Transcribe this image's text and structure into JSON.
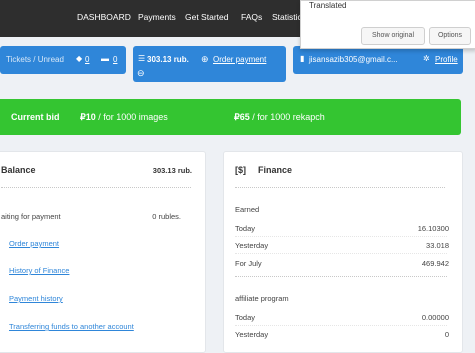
{
  "topnav": {
    "items": [
      "DASHBOARD",
      "Payments",
      "Get Started",
      "FAQs",
      "Statistics"
    ]
  },
  "infobar": {
    "tickets_label": "Tickets / Unread",
    "tickets_count": "0",
    "unread_count": "0",
    "balance": "303.13 rub.",
    "order_payment": "Order payment",
    "email": "jisansazib305@gmail.c...",
    "profile": "Profile"
  },
  "bid": {
    "label": "Current bid",
    "rate1_price": "₽10",
    "rate1_desc": "/ for 1000 images",
    "rate2_price": "₽65",
    "rate2_desc": "/ for 1000 rekapch"
  },
  "balance_card": {
    "title": "Balance",
    "amount": "303.13 rub.",
    "waiting_label": "aiting for payment",
    "waiting_value": "0 rubles.",
    "links": [
      "Order payment",
      "History of Finance",
      "Payment history",
      "Transferring funds to another account"
    ]
  },
  "finance_card": {
    "icon_text": "[$]",
    "title": "Finance",
    "earned_label": "Earned",
    "earned_rows": [
      {
        "label": "Today",
        "value": "16.10300"
      },
      {
        "label": "Yesterday",
        "value": "33.018"
      },
      {
        "label": "For July",
        "value": "469.942"
      }
    ],
    "affiliate_label": "affiliate program",
    "affiliate_rows": [
      {
        "label": "Today",
        "value": "0.00000"
      },
      {
        "label": "Yesterday",
        "value": "0"
      }
    ]
  },
  "translate_popup": {
    "title": "Translated",
    "show_original": "Show original",
    "options": "Options"
  },
  "colors": {
    "nav_bg": "#2e2e2e",
    "accent_blue": "#2f86d9",
    "bid_green": "#34c531",
    "page_bg": "#eef1f5"
  }
}
